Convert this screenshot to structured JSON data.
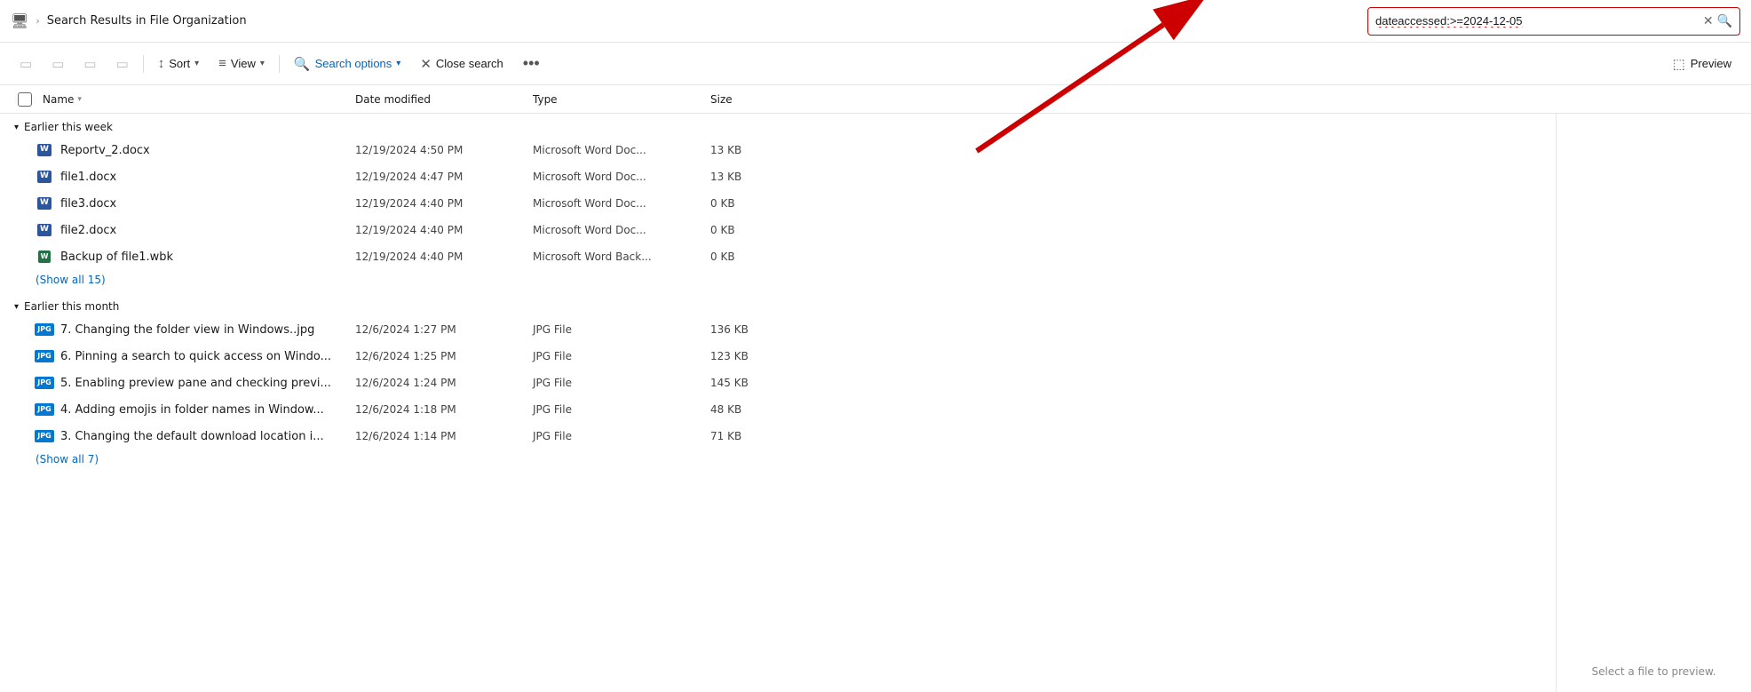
{
  "titleBar": {
    "monitorIcon": "🖥",
    "chevron": "›",
    "title": "Search Results in File Organization"
  },
  "searchBox": {
    "value": "dateaccessed:>=2024-12-05",
    "clearLabel": "✕",
    "searchIconLabel": "🔍"
  },
  "toolbar": {
    "copyBtn": "📋",
    "renameBtn": "✏",
    "shareBtn": "↗",
    "deleteBtn": "🗑",
    "sortLabel": "Sort",
    "sortIcon": "↕",
    "viewLabel": "View",
    "viewIcon": "≡",
    "searchOptionsLabel": "Search options",
    "searchOptionsIcon": "🔍",
    "closeSearchLabel": "Close search",
    "closeSearchIcon": "✕",
    "moreLabel": "•••",
    "previewLabel": "Preview",
    "previewIcon": "⬚"
  },
  "columns": {
    "name": "Name",
    "dateModified": "Date modified",
    "type": "Type",
    "size": "Size"
  },
  "groups": [
    {
      "id": "earlier-this-week",
      "label": "Earlier this week",
      "showAll": "(Show all 15)",
      "files": [
        {
          "name": "Reportv_2.docx",
          "date": "12/19/2024 4:50 PM",
          "type": "Microsoft Word Doc...",
          "size": "13 KB",
          "iconType": "word"
        },
        {
          "name": "file1.docx",
          "date": "12/19/2024 4:47 PM",
          "type": "Microsoft Word Doc...",
          "size": "13 KB",
          "iconType": "word"
        },
        {
          "name": "file3.docx",
          "date": "12/19/2024 4:40 PM",
          "type": "Microsoft Word Doc...",
          "size": "0 KB",
          "iconType": "word"
        },
        {
          "name": "file2.docx",
          "date": "12/19/2024 4:40 PM",
          "type": "Microsoft Word Doc...",
          "size": "0 KB",
          "iconType": "word"
        },
        {
          "name": "Backup of file1.wbk",
          "date": "12/19/2024 4:40 PM",
          "type": "Microsoft Word Back...",
          "size": "0 KB",
          "iconType": "wbk"
        }
      ]
    },
    {
      "id": "earlier-this-month",
      "label": "Earlier this month",
      "showAll": "(Show all 7)",
      "files": [
        {
          "name": "7. Changing the folder view in Windows..jpg",
          "date": "12/6/2024 1:27 PM",
          "type": "JPG File",
          "size": "136 KB",
          "iconType": "jpg"
        },
        {
          "name": "6. Pinning a search to quick access on Windo...",
          "date": "12/6/2024 1:25 PM",
          "type": "JPG File",
          "size": "123 KB",
          "iconType": "jpg"
        },
        {
          "name": "5. Enabling preview pane and checking previ...",
          "date": "12/6/2024 1:24 PM",
          "type": "JPG File",
          "size": "145 KB",
          "iconType": "jpg"
        },
        {
          "name": "4. Adding emojis in folder names in Window...",
          "date": "12/6/2024 1:18 PM",
          "type": "JPG File",
          "size": "48 KB",
          "iconType": "jpg"
        },
        {
          "name": "3. Changing the default download location i...",
          "date": "12/6/2024 1:14 PM",
          "type": "JPG File",
          "size": "71 KB",
          "iconType": "jpg"
        }
      ]
    }
  ],
  "previewPanel": {
    "emptyText": "Select a file to preview."
  }
}
